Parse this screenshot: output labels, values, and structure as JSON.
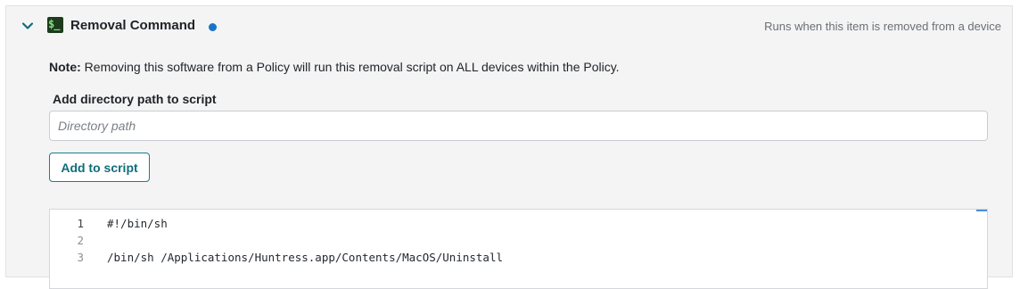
{
  "section": {
    "title": "Removal Command",
    "hint": "Runs when this item is removed from a device",
    "status_dot_color": "#1a73c9",
    "icon": "terminal-icon",
    "icon_glyph": "$_"
  },
  "note": {
    "label": "Note:",
    "text": " Removing this software from a Policy will run this removal script on ALL devices within the Policy."
  },
  "directory": {
    "label": "Add directory path to script",
    "placeholder": "Directory path",
    "value": ""
  },
  "add_button_label": "Add to script",
  "editor": {
    "lines": [
      {
        "number": "1",
        "code": "#!/bin/sh"
      },
      {
        "number": "2",
        "code": ""
      },
      {
        "number": "3",
        "code": "/bin/sh /Applications/Huntress.app/Contents/MacOS/Uninstall"
      }
    ]
  },
  "colors": {
    "accent": "#106d7c",
    "panel_bg": "#f4f4f4"
  }
}
